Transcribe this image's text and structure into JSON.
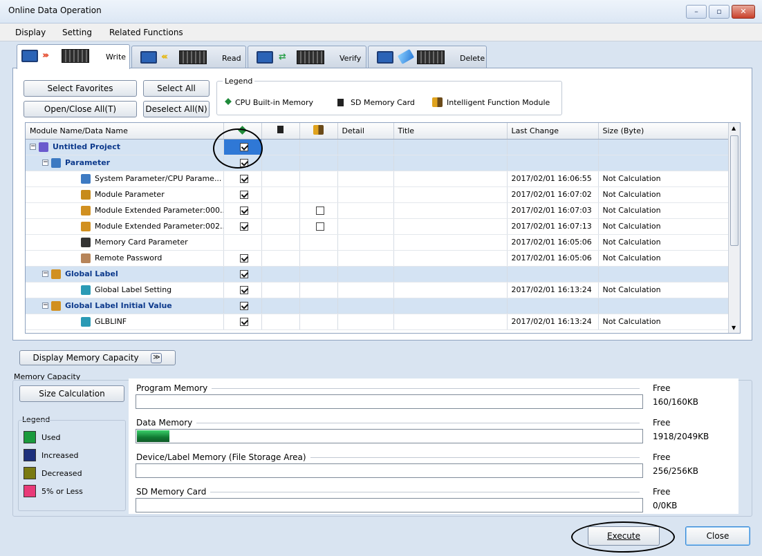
{
  "window": {
    "title": "Online Data Operation"
  },
  "menu": {
    "display": "Display",
    "setting": "Setting",
    "related": "Related Functions"
  },
  "tabs": [
    {
      "label": "Write"
    },
    {
      "label": "Read"
    },
    {
      "label": "Verify"
    },
    {
      "label": "Delete"
    }
  ],
  "toolbar": {
    "select_favorites": "Select Favorites",
    "select_all": "Select All",
    "open_close_all": "Open/Close All(T)",
    "deselect_all": "Deselect All(N)"
  },
  "legend": {
    "title": "Legend",
    "cpu": "CPU Built-in Memory",
    "sd": "SD Memory Card",
    "ifm": "Intelligent Function Module"
  },
  "grid": {
    "headers": {
      "name": "Module Name/Data Name",
      "detail": "Detail",
      "title": "Title",
      "last_change": "Last Change",
      "size": "Size (Byte)"
    },
    "rows": [
      {
        "name": "Untitled Project",
        "cpu": true,
        "ifm": null,
        "last_change": "",
        "size": "",
        "group": true
      },
      {
        "name": "Parameter",
        "cpu": true,
        "ifm": null,
        "last_change": "",
        "size": "",
        "group": true
      },
      {
        "name": "System Parameter/CPU Parame...",
        "cpu": true,
        "ifm": null,
        "last_change": "2017/02/01 16:06:55",
        "size": "Not Calculation",
        "group": false
      },
      {
        "name": "Module Parameter",
        "cpu": true,
        "ifm": null,
        "last_change": "2017/02/01 16:07:02",
        "size": "Not Calculation",
        "group": false
      },
      {
        "name": "Module Extended Parameter:000...",
        "cpu": true,
        "ifm": false,
        "last_change": "2017/02/01 16:07:03",
        "size": "Not Calculation",
        "group": false
      },
      {
        "name": "Module Extended Parameter:002...",
        "cpu": true,
        "ifm": false,
        "last_change": "2017/02/01 16:07:13",
        "size": "Not Calculation",
        "group": false
      },
      {
        "name": "Memory Card Parameter",
        "cpu": null,
        "ifm": null,
        "last_change": "2017/02/01 16:05:06",
        "size": "Not Calculation",
        "group": false
      },
      {
        "name": "Remote Password",
        "cpu": true,
        "ifm": null,
        "last_change": "2017/02/01 16:05:06",
        "size": "Not Calculation",
        "group": false
      },
      {
        "name": "Global Label",
        "cpu": true,
        "ifm": null,
        "last_change": "",
        "size": "",
        "group": true
      },
      {
        "name": "Global Label Setting",
        "cpu": true,
        "ifm": null,
        "last_change": "2017/02/01 16:13:24",
        "size": "Not Calculation",
        "group": false
      },
      {
        "name": "Global Label Initial Value",
        "cpu": true,
        "ifm": null,
        "last_change": "",
        "size": "",
        "group": true
      },
      {
        "name": "GLBLINF",
        "cpu": true,
        "ifm": null,
        "last_change": "2017/02/01 16:13:24",
        "size": "Not Calculation",
        "group": false
      }
    ]
  },
  "capacity": {
    "toggle_label": "Display Memory Capacity",
    "group_title": "Memory Capacity",
    "size_calc": "Size Calculation",
    "legend_title": "Legend",
    "legend_items": [
      {
        "label": "Used",
        "color": "#1a9a3d"
      },
      {
        "label": "Increased",
        "color": "#1c2f7c"
      },
      {
        "label": "Decreased",
        "color": "#7a7a12"
      },
      {
        "label": "5% or Less",
        "color": "#e83a78"
      }
    ],
    "free_label": "Free",
    "memories": [
      {
        "name": "Program Memory",
        "free": "160/160KB",
        "used_fraction": 0
      },
      {
        "name": "Data Memory",
        "free": "1918/2049KB",
        "used_fraction": 0.064
      },
      {
        "name": "Device/Label Memory (File Storage Area)",
        "free": "256/256KB",
        "used_fraction": 0
      },
      {
        "name": "SD Memory Card",
        "free": "0/0KB",
        "used_fraction": 0
      }
    ]
  },
  "footer": {
    "execute": "Execute",
    "close": "Close"
  }
}
